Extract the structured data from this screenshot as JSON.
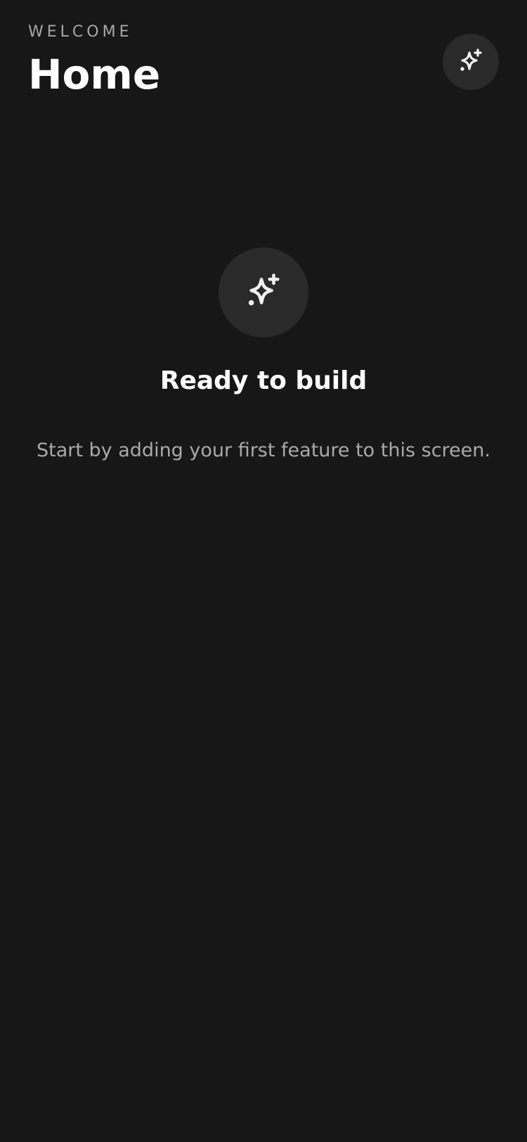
{
  "header": {
    "eyebrow": "WELCOME",
    "title": "Home",
    "action_icon": "sparkle-plus-icon"
  },
  "empty_state": {
    "icon": "sparkle-plus-icon",
    "title": "Ready to build",
    "description": "Start by adding your first feature to this screen."
  },
  "colors": {
    "background": "#171717",
    "surface": "#2a2a2a",
    "primary_text": "#ffffff",
    "secondary_text": "#a9a9a9"
  }
}
